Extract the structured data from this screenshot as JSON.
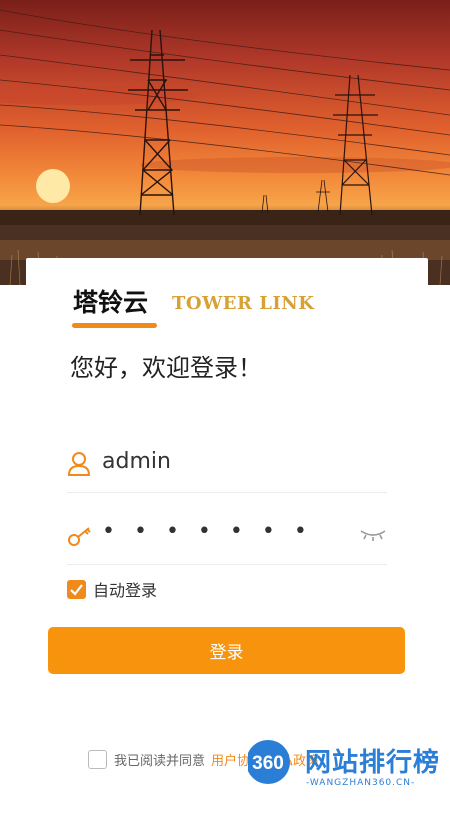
{
  "brand": {
    "title": "塔铃云",
    "subtitle": "TOWER LINK"
  },
  "greeting": "您好，欢迎登录！",
  "login_form": {
    "username_value": "admin",
    "password_mask": "• • • • • • •",
    "auto_login_label": "自动登录",
    "auto_login_checked": true,
    "submit_label": "登录"
  },
  "agreement": {
    "prefix": "我已阅读并同意",
    "user_agreement_link": "用户协议",
    "privacy_link": "隐私政策",
    "checked": false
  },
  "watermark": {
    "badge": "360",
    "text": "网站排行榜",
    "url": "-WANGZHAN360.CN-"
  },
  "colors": {
    "accent": "#f7930d",
    "brand_sub": "#d8a136",
    "watermark": "#2b7ed6"
  },
  "icons": {
    "user": "user-icon",
    "password": "key-icon",
    "eye": "eye-closed-icon",
    "check": "check-icon"
  }
}
